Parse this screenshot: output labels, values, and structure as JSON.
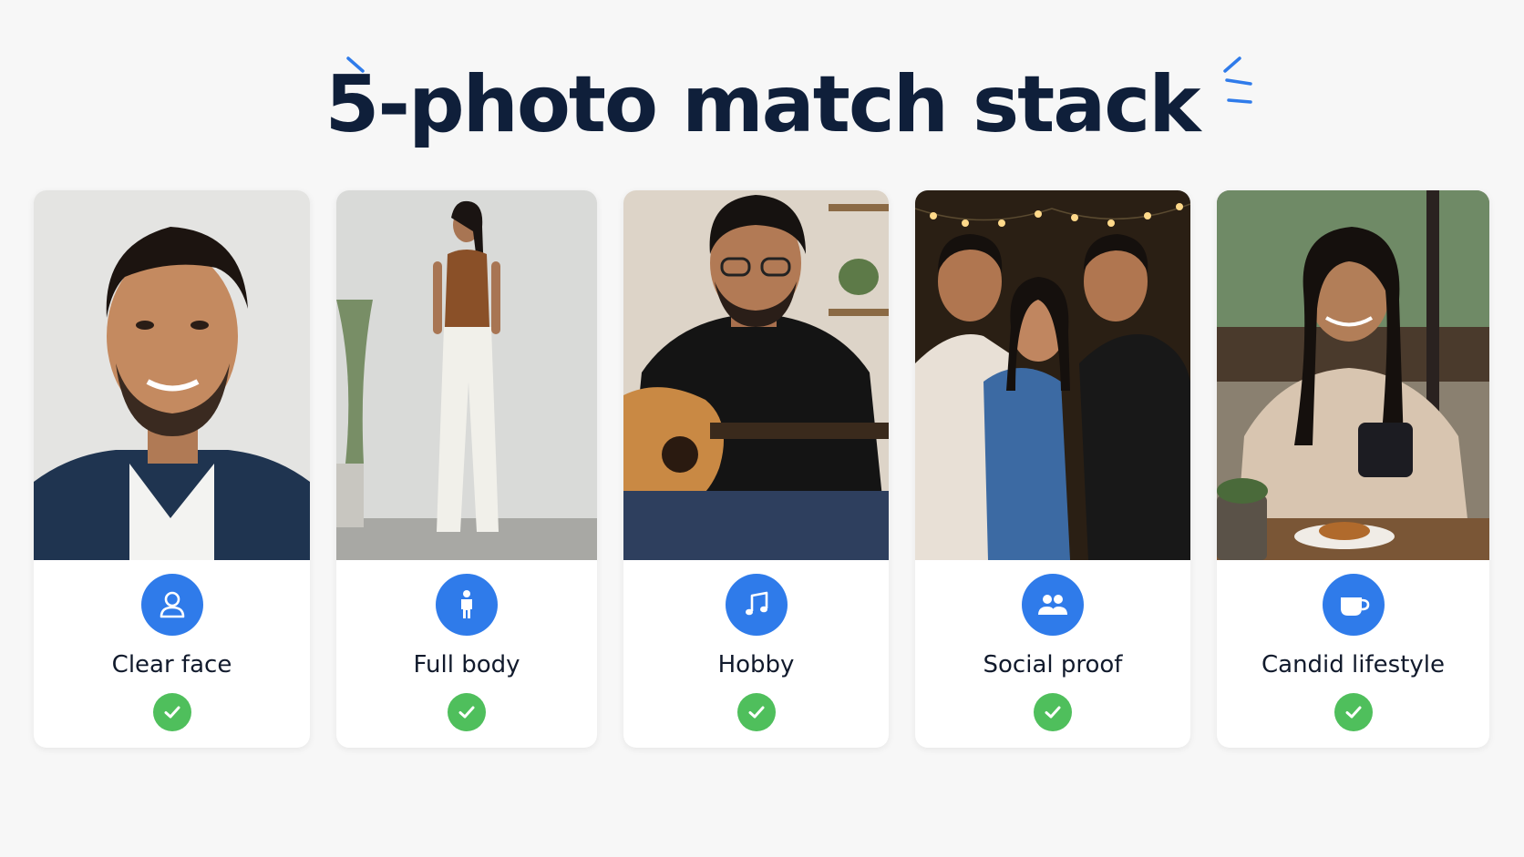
{
  "title": "5-photo match stack",
  "colors": {
    "title": "#0f1f3a",
    "accent": "#2f7bea",
    "check": "#4fbf5c",
    "card": "#ffffff",
    "background": "#f7f7f7"
  },
  "cards": [
    {
      "label": "Clear face",
      "icon": "person-icon",
      "status": "checked"
    },
    {
      "label": "Full body",
      "icon": "standing-figure-icon",
      "status": "checked"
    },
    {
      "label": "Hobby",
      "icon": "music-note-icon",
      "status": "checked"
    },
    {
      "label": "Social proof",
      "icon": "group-icon",
      "status": "checked"
    },
    {
      "label": "Candid lifestyle",
      "icon": "coffee-cup-icon",
      "status": "checked"
    }
  ]
}
